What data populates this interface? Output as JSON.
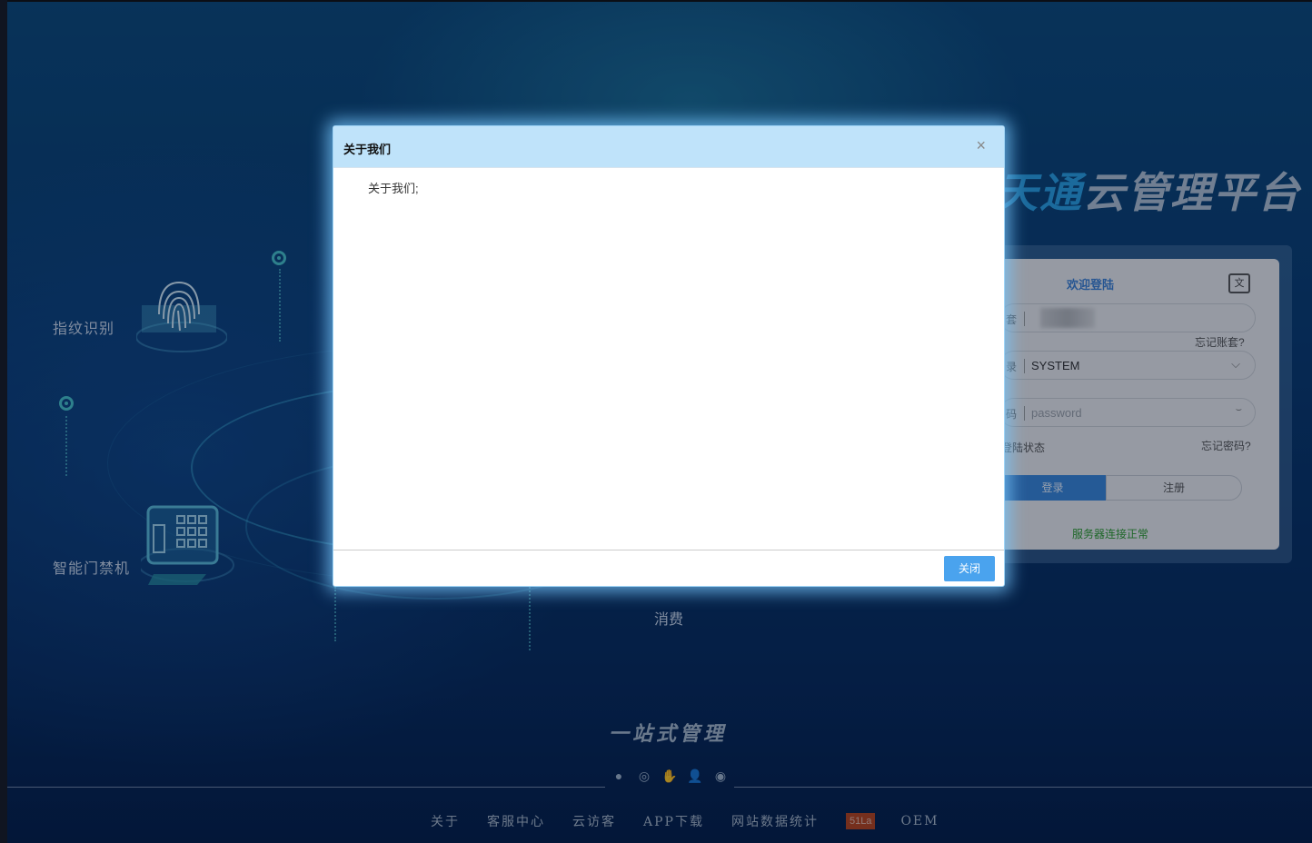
{
  "background": {
    "features": {
      "fingerprint": "指纹识别",
      "access_control": "智能门禁机",
      "consume": "消费"
    },
    "logo": {
      "accent_text": "天通",
      "text": "云管理平台"
    },
    "slogan": "一站式管理"
  },
  "login": {
    "title": "欢迎登陆",
    "lang_icon": "translate-icon",
    "account_prefix": "套",
    "forgot_account": "忘记账套?",
    "role_prefix": "录",
    "role_value": "SYSTEM",
    "password_prefix": "码",
    "password_placeholder": "password",
    "remember": "登陆状态",
    "forgot_password": "忘记密码?",
    "login_button": "登录",
    "register_button": "注册",
    "server_status": "服务器连接正常"
  },
  "footer": {
    "links": [
      "关于",
      "客服中心",
      "云访客",
      "APP下载",
      "网站数据统计"
    ],
    "badge": "51La",
    "oem": "OEM"
  },
  "modal": {
    "title": "关于我们",
    "content": "关于我们;",
    "close_button": "关闭",
    "close_x": "×"
  },
  "colors": {
    "modal_header": "#bfe3fa",
    "primary_button": "#4aa3ee",
    "login_accent": "#3a86d8",
    "status_ok": "#2e9a2e"
  }
}
